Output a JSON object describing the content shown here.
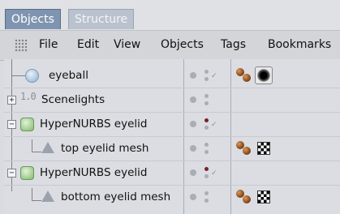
{
  "tabs": [
    {
      "label": "Objects",
      "active": true
    },
    {
      "label": "Structure",
      "active": false
    }
  ],
  "menu": [
    "File",
    "Edit",
    "View",
    "Objects",
    "Tags",
    "Bookmarks"
  ],
  "rows": [
    {
      "name": "eyeball",
      "icon": "sphere-icon",
      "tags": [
        "material-tag",
        "eyeball-texture-tag"
      ]
    },
    {
      "name": "Scenelights",
      "icon": "null-object-icon",
      "tags": []
    },
    {
      "name": "HyperNURBS eyelid",
      "icon": "hypernurbs-icon",
      "tags": []
    },
    {
      "name": "top eyelid mesh",
      "icon": "polygon-mesh-icon",
      "tags": [
        "material-tag",
        "checker-texture-tag"
      ]
    },
    {
      "name": "HyperNURBS eyelid",
      "icon": "hypernurbs-icon",
      "tags": []
    },
    {
      "name": "bottom eyelid mesh",
      "icon": "polygon-mesh-icon",
      "tags": [
        "material-tag",
        "checker-texture-tag"
      ]
    }
  ],
  "colors": {
    "active_tab": "#7f94b0",
    "background": "#dbdde2",
    "material": "#7a3d12",
    "active_dot": "#7a2030"
  }
}
